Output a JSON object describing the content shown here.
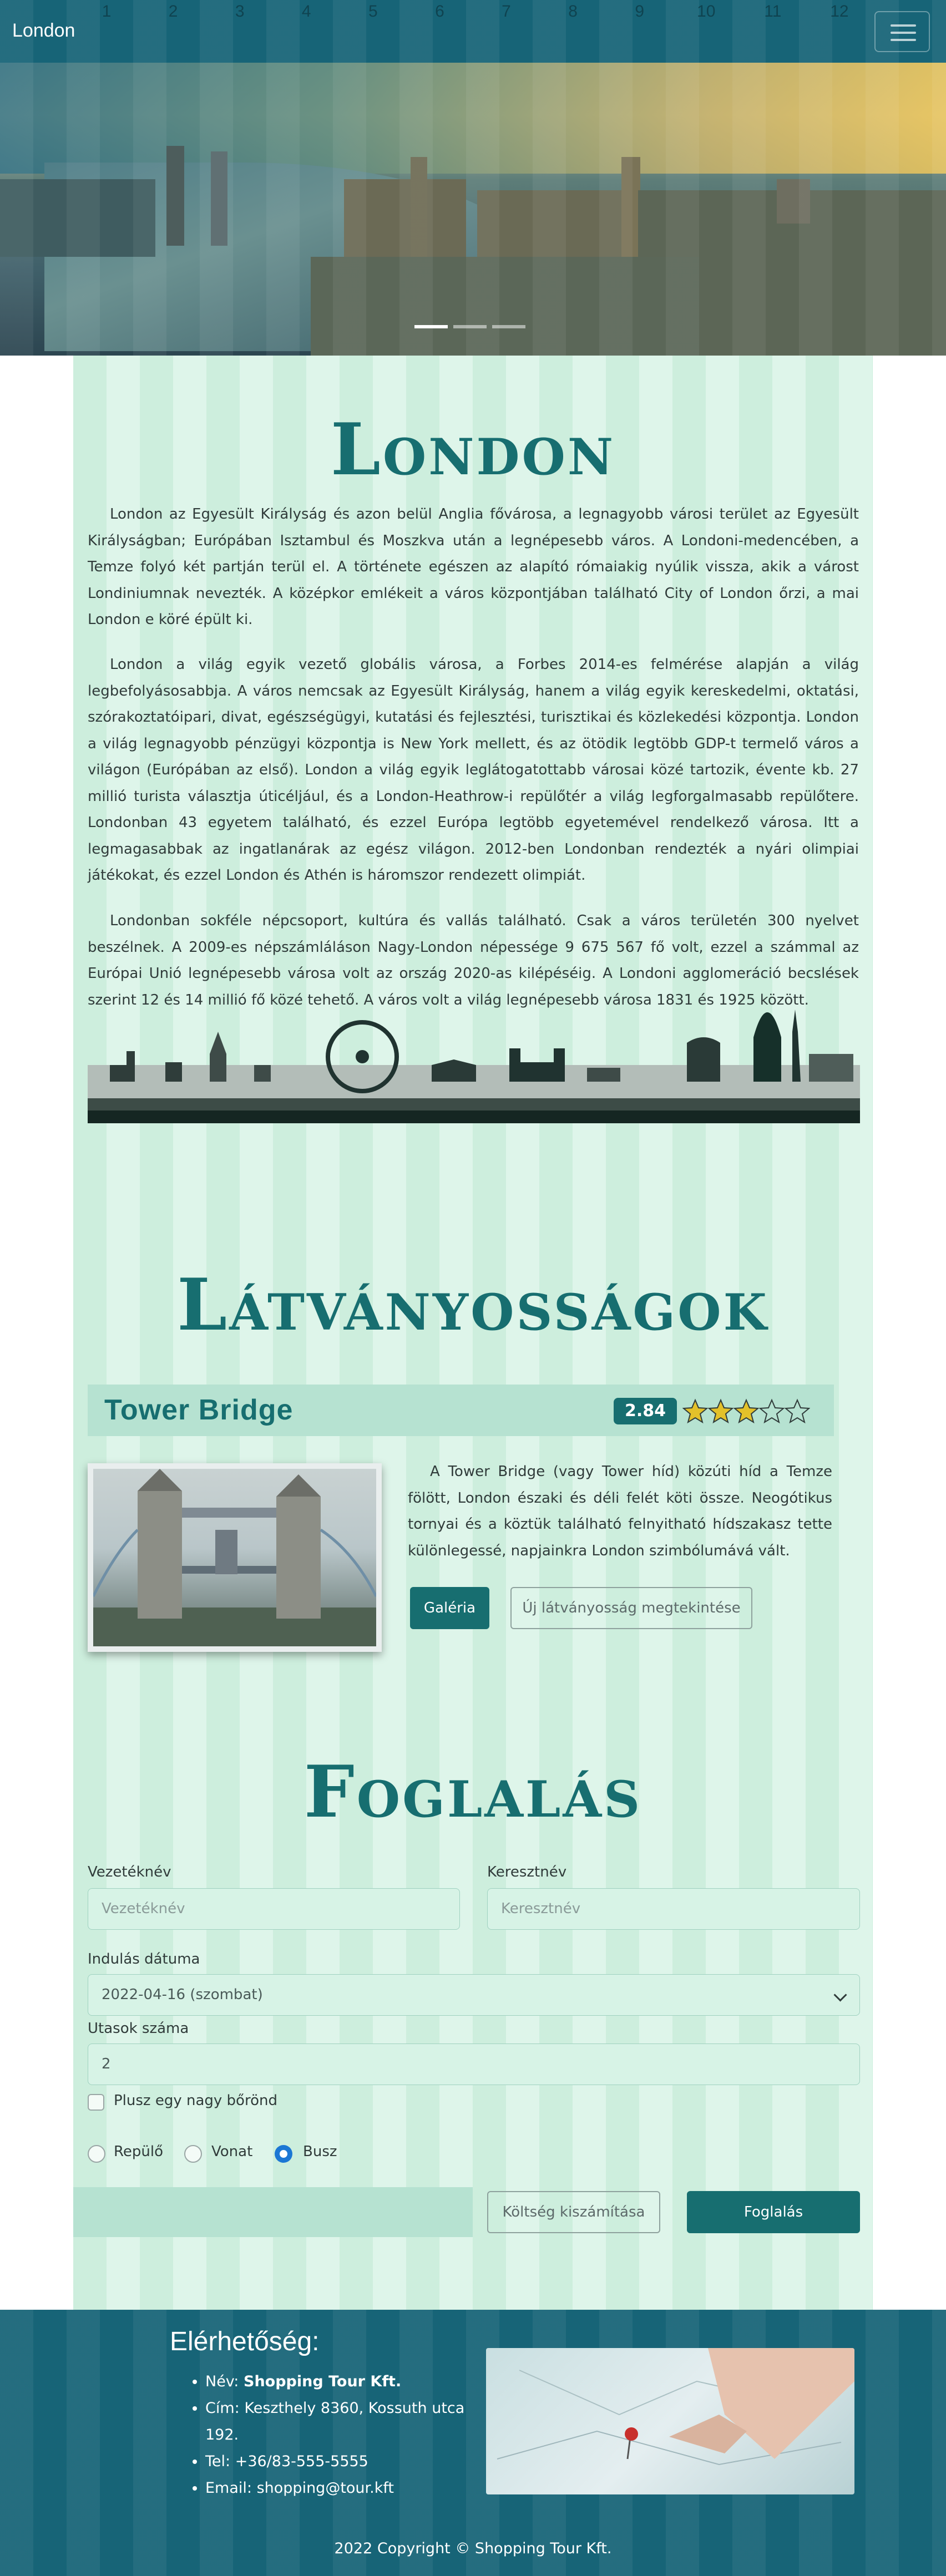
{
  "navbar": {
    "brand": "London",
    "column_numbers": [
      "1",
      "2",
      "3",
      "4",
      "5",
      "6",
      "7",
      "8",
      "9",
      "10",
      "11",
      "12"
    ],
    "toggler_icon": "hamburger-menu-icon"
  },
  "hero": {
    "carousel_slide_count": 3,
    "active_slide": 1
  },
  "intro": {
    "title": "London",
    "paragraphs": [
      "London az Egyesült Királyság és azon belül Anglia fővárosa, a legnagyobb városi terület az Egyesült Királyságban; Európában Isztambul és Moszkva után a legnépesebb város. A Londoni-medencében, a Temze folyó két partján terül el. A története egészen az alapító rómaiakig nyúlik vissza, akik a várost Londiniumnak nevezték. A középkor emlékeit a város központjában található City of London őrzi, a mai London e köré épült ki.",
      "London a világ egyik vezető globális városa, a Forbes 2014-es felmérése alapján a világ legbefolyásosabbja. A város nemcsak az Egyesült Királyság, hanem a világ egyik kereskedelmi, oktatási, szórakoztatóipari, divat, egészségügyi, kutatási és fejlesztési, turisztikai és közlekedési központja. London a világ legnagyobb pénzügyi központja is New York mellett, és az ötödik legtöbb GDP-t termelő város a világon (Európában az első). London a világ egyik leglátogatottabb városai közé tartozik, évente kb. 27 millió turista választja úticéljául, és a London-Heathrow-i repülőtér a világ legforgalmasabb repülőtere. Londonban 43 egyetem található, és ezzel Európa legtöbb egyetemével rendelkező városa. Itt a legmagasabbak az ingatlanárak az egész világon. 2012-ben Londonban rendezték a nyári olimpiai játékokat, és ezzel London és Athén is háromszor rendezett olimpiát.",
      "Londonban sokféle népcsoport, kultúra és vallás található. Csak a város területén 300 nyelvet beszélnek. A 2009-es népszámláláson Nagy-London népessége 9 675 567 fő volt, ezzel a számmal az Európai Unió legnépesebb városa volt az ország 2020-as kilépéséig. A Londoni agglomeráció becslések szerint 12 és 14 millió fő közé tehető. A város volt a világ legnépesebb városa 1831 és 1925 között."
    ]
  },
  "sights": {
    "title": "Látványosságok",
    "item": {
      "name": "Tower Bridge",
      "rating_value": "2.84",
      "rating_out_of": 5,
      "description": "A Tower Bridge (vagy Tower híd) közúti híd a Temze fölött, London északi és déli felét köti össze. Neogótikus tornyai és a köztük található felnyitható hídszakasz tette különlegessé, napjainkra London szimbólumává vált.",
      "gallery_button": "Galéria",
      "new_sight_button": "Új látványosság megtekintése"
    }
  },
  "booking": {
    "title": "Foglalás",
    "last_name": {
      "label": "Vezetéknév",
      "placeholder": "Vezetéknév"
    },
    "first_name": {
      "label": "Keresztnév",
      "placeholder": "Keresztnév"
    },
    "departure": {
      "label": "Indulás dátuma",
      "value": "2022-04-16 (szombat)"
    },
    "passengers": {
      "label": "Utasok száma",
      "value": "2"
    },
    "extra_luggage": {
      "label": "Plusz egy nagy bőrönd",
      "checked": false
    },
    "transport": {
      "options": [
        "Repülő",
        "Vonat",
        "Busz"
      ],
      "selected": "Busz"
    },
    "cost_button": "Költség kiszámítása",
    "submit_button": "Foglalás"
  },
  "footer": {
    "contact_title": "Elérhetőség:",
    "name_label": "Név: ",
    "name_value": "Shopping Tour Kft.",
    "address": "Cím: Keszthely 8360, Kossuth utca 192.",
    "phone": "Tel: +36/83-555-5555",
    "email": "Email: shopping@tour.kft",
    "copyright": "2022 Copyright © Shopping Tour Kft."
  },
  "colors": {
    "navbar": "#176477",
    "accent": "#176e70",
    "grid_light": "#def5ea",
    "grid_dark": "#cdeedd",
    "radio_selected": "#1c77d4",
    "star_fill": "#e3c12a"
  }
}
